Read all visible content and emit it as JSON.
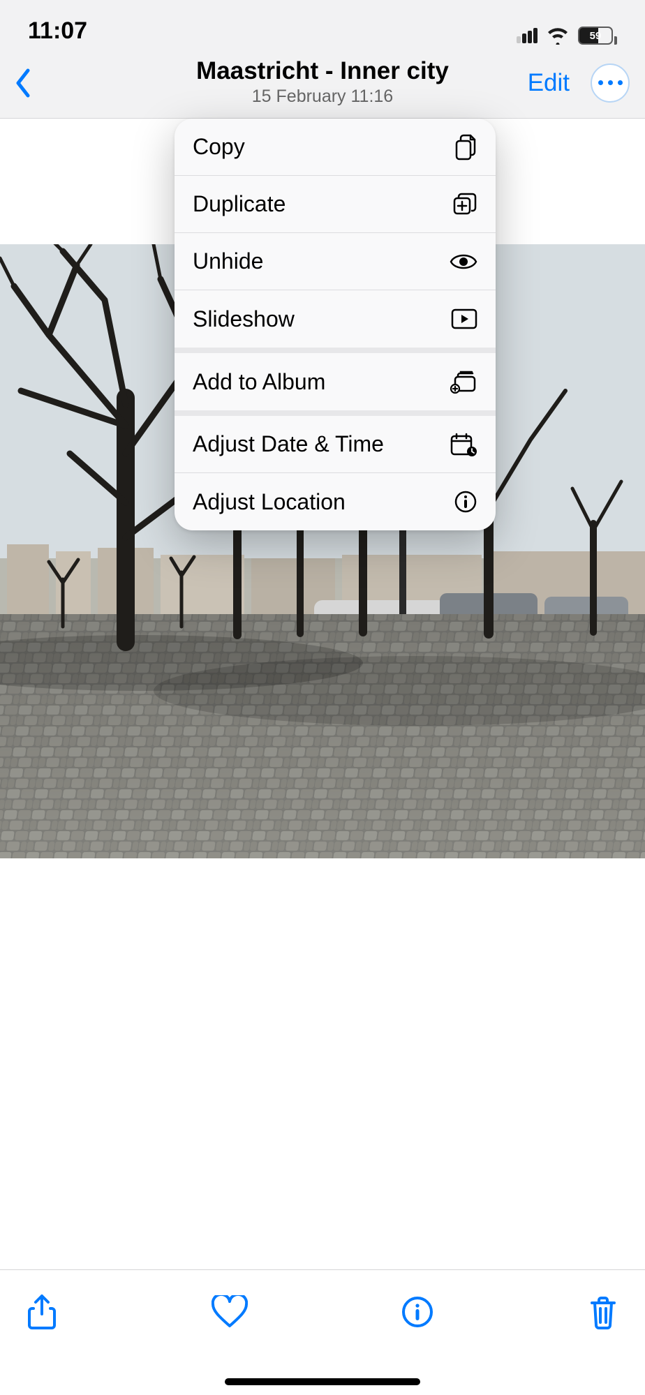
{
  "statusbar": {
    "time": "11:07",
    "battery_pct": "59"
  },
  "navbar": {
    "title": "Maastricht - Inner city",
    "subtitle": "15 February  11:16",
    "edit_label": "Edit"
  },
  "menu": {
    "group1": {
      "copy": "Copy",
      "duplicate": "Duplicate",
      "unhide": "Unhide",
      "slideshow": "Slideshow"
    },
    "group2": {
      "add_album": "Add to Album"
    },
    "group3": {
      "adjust_date": "Adjust Date & Time",
      "adjust_location": "Adjust Location"
    }
  }
}
